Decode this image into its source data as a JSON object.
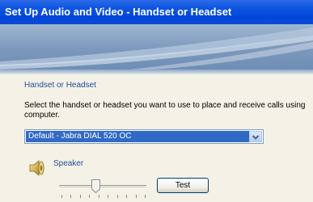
{
  "window": {
    "title": "Set Up Audio and Video - Handset or Headset"
  },
  "section": {
    "title": "Handset or Headset",
    "instructions_line1": "Select the handset or headset you want to use to place and receive calls using",
    "instructions_line2": "computer."
  },
  "device_select": {
    "value": "Default - Jabra DIAL 520 OC"
  },
  "speaker": {
    "label": "Speaker",
    "volume_fraction": 0.4,
    "test_label": "Test"
  },
  "colors": {
    "title_bar": "#0a4bd6",
    "selection": "#316ac5",
    "section_text": "#2a4d9a"
  }
}
